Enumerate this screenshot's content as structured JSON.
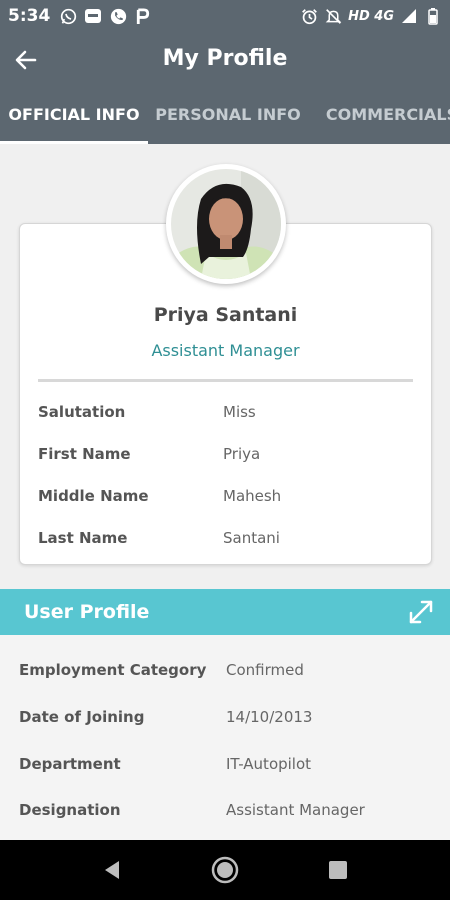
{
  "status_bar": {
    "time": "5:34",
    "network": "HD 4G"
  },
  "app_bar": {
    "title": "My Profile"
  },
  "tabs": [
    {
      "label": "OFFICIAL INFO",
      "active": true
    },
    {
      "label": "PERSONAL INFO",
      "active": false
    },
    {
      "label": "COMMERCIALS",
      "active": false
    }
  ],
  "profile": {
    "name": "Priya Santani",
    "role": "Assistant Manager",
    "fields": [
      {
        "label": "Salutation",
        "value": "Miss"
      },
      {
        "label": "First Name",
        "value": "Priya"
      },
      {
        "label": "Middle Name",
        "value": "Mahesh"
      },
      {
        "label": "Last Name",
        "value": "Santani"
      }
    ]
  },
  "user_profile": {
    "title": "User Profile",
    "fields": [
      {
        "label": "Employment Category",
        "value": "Confirmed"
      },
      {
        "label": "Date of Joining",
        "value": "14/10/2013"
      },
      {
        "label": "Department",
        "value": "IT-Autopilot"
      },
      {
        "label": "Designation",
        "value": "Assistant Manager"
      }
    ]
  },
  "colors": {
    "header": "#5c6770",
    "accent": "#58c6d1",
    "role_text": "#2f8f94"
  }
}
